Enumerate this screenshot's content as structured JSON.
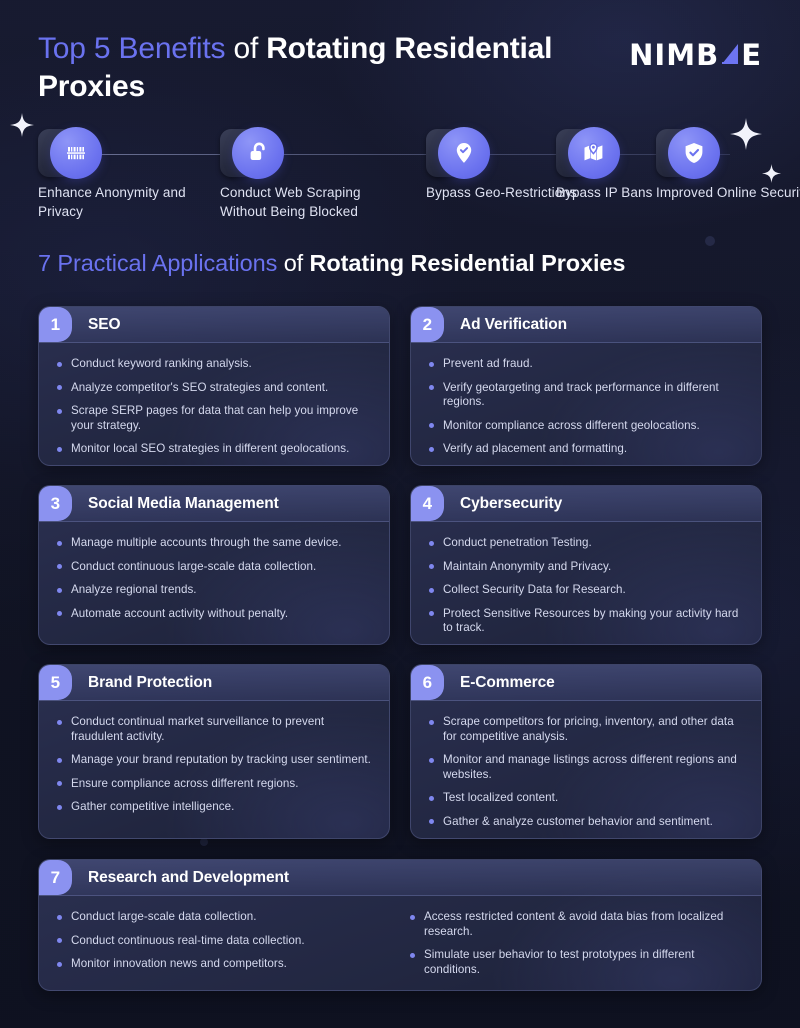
{
  "brand": {
    "logo_text_before": "NIMB",
    "logo_icon": "stair-triangle-icon",
    "logo_text_after": "E"
  },
  "header": {
    "title_accent": "Top 5 Benefits",
    "title_light": " of ",
    "title_bold": "Rotating Residential Proxies",
    "accent_color": "#6a72ef"
  },
  "benefits": [
    {
      "icon": "anonymity-mask-icon",
      "label": "Enhance Anonymity and Privacy"
    },
    {
      "icon": "unlocked-padlock-icon",
      "label": "Conduct Web Scraping Without Being Blocked"
    },
    {
      "icon": "map-pin-check-icon",
      "label": "Bypass Geo-Restrictions"
    },
    {
      "icon": "folded-map-pin-icon",
      "label": "Bypass IP Bans"
    },
    {
      "icon": "shield-check-icon",
      "label": "Improved Online Security"
    }
  ],
  "section": {
    "heading_accent": "7 Practical Applications",
    "heading_light": " of ",
    "heading_bold": "Rotating Residential Proxies"
  },
  "cards": [
    {
      "number": "1",
      "title": "SEO",
      "items": [
        "Conduct keyword ranking analysis.",
        "Analyze competitor's SEO strategies and content.",
        "Scrape SERP pages for data that can help you improve your strategy.",
        "Monitor local SEO strategies in different geolocations."
      ]
    },
    {
      "number": "2",
      "title": "Ad Verification",
      "items": [
        "Prevent ad fraud.",
        "Verify geotargeting and track performance in different regions.",
        "Monitor compliance across different geolocations.",
        "Verify ad placement and formatting."
      ]
    },
    {
      "number": "3",
      "title": "Social Media Management",
      "items": [
        "Manage multiple accounts through the same device.",
        "Conduct continuous large-scale data collection.",
        "Analyze regional trends.",
        "Automate account activity without penalty."
      ]
    },
    {
      "number": "4",
      "title": "Cybersecurity",
      "items": [
        "Conduct penetration Testing.",
        "Maintain Anonymity and Privacy.",
        "Collect Security Data for Research.",
        "Protect Sensitive Resources by making your activity hard to track."
      ]
    },
    {
      "number": "5",
      "title": "Brand Protection",
      "items": [
        "Conduct continual market surveillance to prevent fraudulent activity.",
        "Manage your brand reputation by tracking user sentiment.",
        "Ensure compliance across different regions.",
        "Gather competitive intelligence."
      ]
    },
    {
      "number": "6",
      "title": "E-Commerce",
      "items": [
        "Scrape competitors for pricing, inventory, and other data for competitive analysis.",
        "Monitor and manage listings across different regions and websites.",
        "Test localized content.",
        "Gather & analyze customer behavior and sentiment."
      ]
    },
    {
      "number": "7",
      "title": "Research and Development",
      "items_left": [
        "Conduct large-scale data collection.",
        "Conduct continuous real-time data collection.",
        "Monitor innovation news and competitors."
      ],
      "items_right": [
        "Access restricted content & avoid data bias from localized research.",
        "Simulate user behavior to test prototypes in different conditions."
      ]
    }
  ],
  "colors": {
    "background": "#0f1221",
    "accent": "#6a72ef",
    "badge": "#8b92f0",
    "bullet": "#7f87ef",
    "body_text": "#d5d9ee",
    "heading_text": "#ffffff"
  }
}
